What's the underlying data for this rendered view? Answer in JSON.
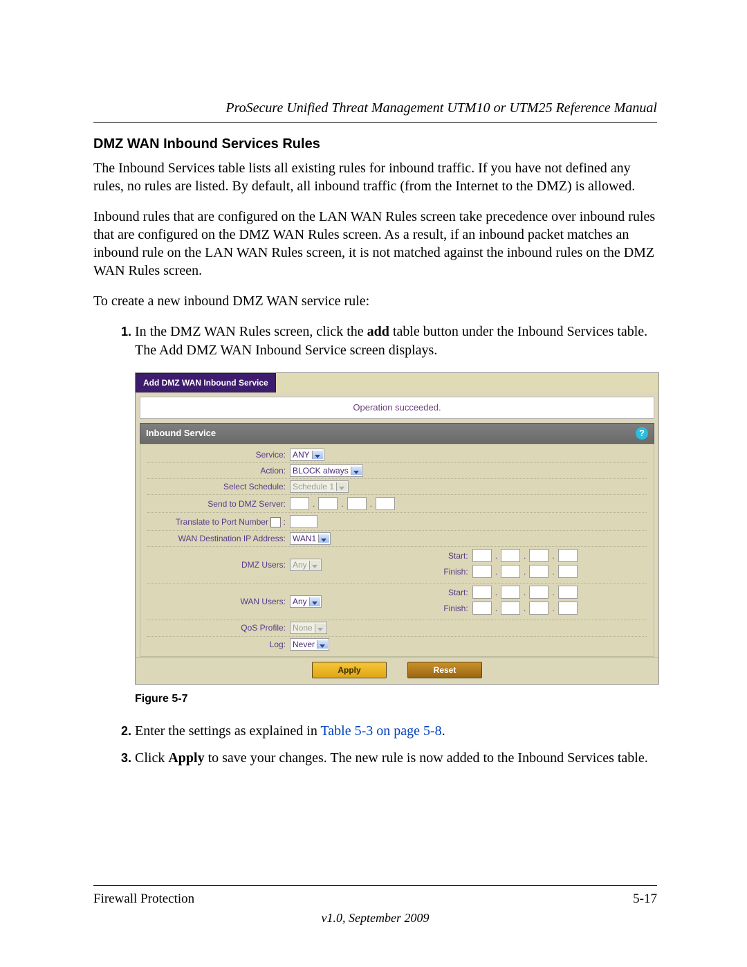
{
  "doc": {
    "running_header": "ProSecure Unified Threat Management UTM10 or UTM25 Reference Manual",
    "heading": "DMZ WAN Inbound Services Rules",
    "para1": "The Inbound Services table lists all existing rules for inbound traffic. If you have not defined any rules, no rules are listed. By default, all inbound traffic (from the Internet to the DMZ) is allowed.",
    "para2": "Inbound rules that are configured on the LAN WAN Rules screen take precedence over inbound rules that are configured on the DMZ WAN Rules screen. As a result, if an inbound packet matches an inbound rule on the LAN WAN Rules screen, it is not matched against the inbound rules on the DMZ WAN Rules screen.",
    "para3": "To create a new inbound DMZ WAN service rule:",
    "step1a": "In the DMZ WAN Rules screen, click the ",
    "step1_bold": "add",
    "step1b": " table button under the Inbound Services table. The Add DMZ WAN Inbound Service screen displays.",
    "step2a": "Enter the settings as explained in ",
    "step2_link": "Table 5-3 on page 5-8",
    "step2b": ".",
    "step3a": "Click ",
    "step3_bold": "Apply",
    "step3b": " to save your changes. The new rule is now added to the Inbound Services table.",
    "figure_caption": "Figure 5-7",
    "footer_left": "Firewall Protection",
    "footer_right": "5-17",
    "footer_center": "v1.0, September 2009"
  },
  "screenshot": {
    "tab": "Add DMZ WAN Inbound Service",
    "status": "Operation succeeded.",
    "section_title": "Inbound Service",
    "labels": {
      "service": "Service:",
      "action": "Action:",
      "select_schedule": "Select Schedule:",
      "send_to_dmz": "Send to DMZ Server:",
      "translate_port": "Translate to Port Number",
      "wan_dest_ip": "WAN Destination IP Address:",
      "dmz_users": "DMZ Users:",
      "wan_users": "WAN Users:",
      "qos_profile": "QoS Profile:",
      "log": "Log:",
      "start": "Start:",
      "finish": "Finish:"
    },
    "values": {
      "service": "ANY",
      "action": "BLOCK always",
      "select_schedule": "Schedule 1",
      "wan_dest_ip": "WAN1",
      "dmz_users": "Any",
      "wan_users": "Any",
      "qos_profile": "None",
      "log": "Never",
      "translate_port_value": ""
    },
    "buttons": {
      "apply": "Apply",
      "reset": "Reset"
    }
  }
}
